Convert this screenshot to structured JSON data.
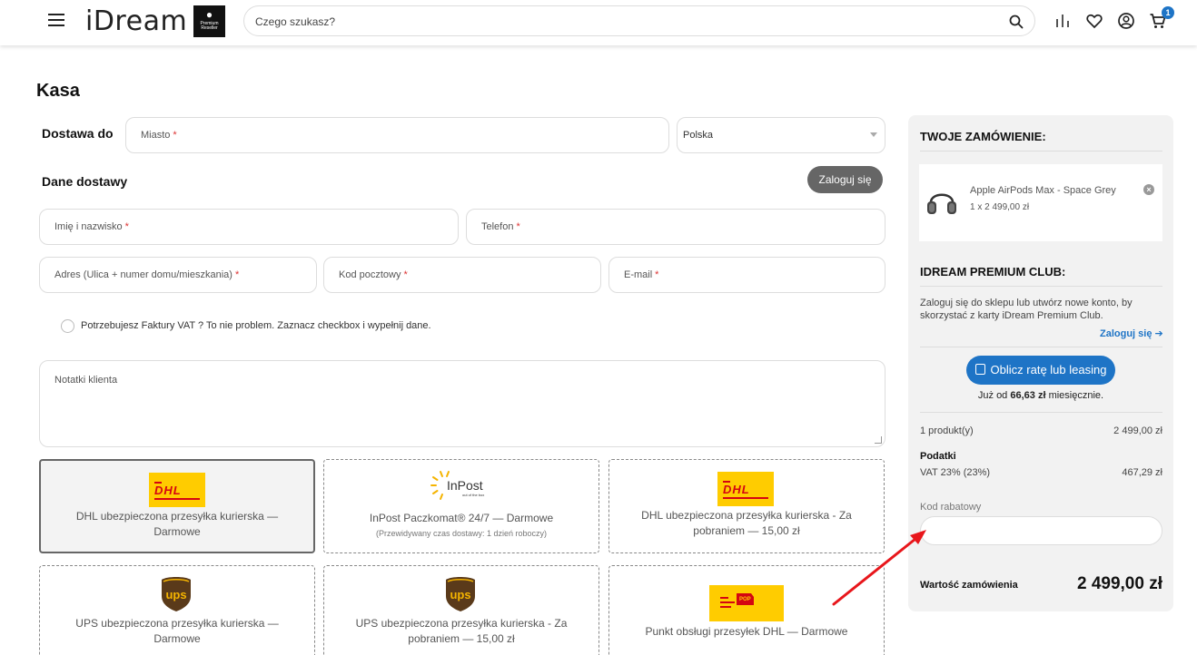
{
  "header": {
    "logo": "iDream",
    "reseller_badge": {
      "line1": "Premium",
      "line2": "Reseller"
    },
    "search_placeholder": "Czego szukasz?",
    "cart_count": "1",
    "icons": [
      "menu-icon",
      "search-icon",
      "compare-icon",
      "heart-icon",
      "user-icon",
      "cart-icon"
    ]
  },
  "page": {
    "title": "Kasa"
  },
  "form": {
    "delivery_to_label": "Dostawa do",
    "city_placeholder": "Miasto",
    "country_value": "Polska",
    "delivery_details_label": "Dane dostawy",
    "login_button": "Zaloguj się",
    "name_placeholder": "Imię i nazwisko",
    "phone_placeholder": "Telefon",
    "address_placeholder": "Adres (Ulica + numer domu/mieszkania)",
    "postal_placeholder": "Kod pocztowy",
    "email_placeholder": "E-mail",
    "required_mark": "*",
    "vat_checkbox_label": "Potrzebujesz Faktury VAT ? To nie problem. Zaznacz checkbox i wypełnij dane.",
    "notes_placeholder": "Notatki klienta"
  },
  "shipping": [
    {
      "name": "DHL ubezpieczona przesyłka kurierska — Darmowe",
      "logo": "DHL",
      "selected": true
    },
    {
      "name": "InPost Paczkomat® 24/7 — Darmowe",
      "sub": "(Przewidywany czas dostawy: 1 dzień roboczy)",
      "logo": "InPost",
      "logo_tagline": "out of the box"
    },
    {
      "name": "DHL ubezpieczona przesyłka kurierska - Za pobraniem — 15,00 zł",
      "logo": "DHL"
    },
    {
      "name": "UPS ubezpieczona przesyłka kurierska — Darmowe",
      "logo": "ups"
    },
    {
      "name": "UPS ubezpieczona przesyłka kurierska - Za pobraniem — 15,00 zł",
      "logo": "ups"
    },
    {
      "name": "Punkt obsługi przesyłek DHL — Darmowe",
      "logo": "POP"
    }
  ],
  "order": {
    "title": "TWOJE ZAMÓWIENIE:",
    "product_name": "Apple AirPods Max - Space Grey",
    "product_qty": "1 x 2 499,00 zł",
    "club_title": "IDREAM PREMIUM CLUB:",
    "club_text": "Zaloguj się do sklepu lub utwórz nowe konto, by skorzystać z karty iDream Premium Club.",
    "club_link": "Zaloguj się",
    "calc_button": "Oblicz ratę lub leasing",
    "installment_prefix": "Już od",
    "installment_amount": "66,63 zł",
    "installment_suffix": "miesięcznie.",
    "products_label": "1 produkt(y)",
    "products_value": "2 499,00 zł",
    "taxes_label": "Podatki",
    "vat_label": "VAT 23% (23%)",
    "vat_value": "467,29 zł",
    "coupon_label": "Kod rabatowy",
    "total_label": "Wartość zamówienia",
    "total_value": "2 499,00 zł"
  },
  "colors": {
    "accent": "#1e74c6",
    "dhl_yellow": "#ffcc00",
    "dhl_red": "#d40511",
    "ups_brown": "#5a3a1a",
    "ups_gold": "#f5b400",
    "annotation_red": "#e8161b"
  }
}
